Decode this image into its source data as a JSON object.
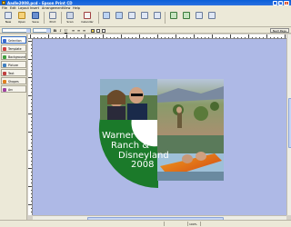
{
  "window": {
    "title": "Aadle2008.pcd - Epson Print CD"
  },
  "menu": [
    "File",
    "Edit",
    "Layout",
    "Insert",
    "Arrangement",
    "View",
    "Help"
  ],
  "toolbar": {
    "new_label": "New",
    "open_label": "Open",
    "save_label": "Save",
    "print_label": "Print",
    "scan_label": "Scan",
    "calendar_label": "Calendar"
  },
  "format_toolbar": {
    "next_page_label": "Next Page"
  },
  "sidebar": {
    "items": [
      {
        "label": "Selection",
        "icon": "arrow-icon",
        "color": "#3a6ad0"
      },
      {
        "label": "Template",
        "icon": "template-icon",
        "color": "#d04040"
      },
      {
        "label": "Background",
        "icon": "background-icon",
        "color": "#40a040"
      },
      {
        "label": "Picture",
        "icon": "picture-icon",
        "color": "#4080c0"
      },
      {
        "label": "Text",
        "icon": "text-icon",
        "color": "#c04040"
      },
      {
        "label": "Shapes",
        "icon": "shapes-icon",
        "color": "#e08020"
      },
      {
        "label": "Arc",
        "icon": "arc-icon",
        "color": "#a040a0"
      }
    ]
  },
  "design": {
    "text_lines": [
      "Warner",
      "Ranch &",
      "Disneyland",
      "2008"
    ],
    "colors": {
      "green": "#1b7a2a",
      "white": "#ffffff",
      "canvas": "#aeb9e6"
    }
  },
  "status": {
    "zoom": "100%"
  }
}
